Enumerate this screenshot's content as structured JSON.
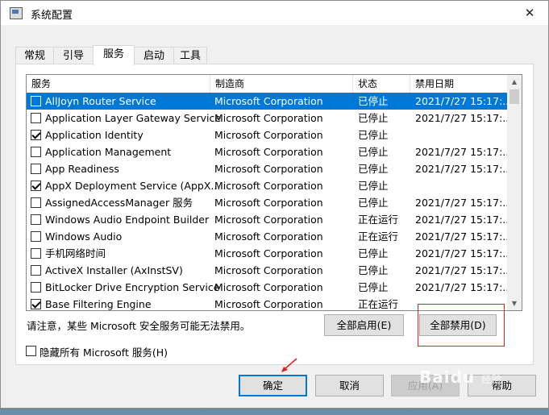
{
  "window": {
    "title": "系统配置",
    "close_glyph": "✕"
  },
  "tabs": [
    {
      "label": "常规"
    },
    {
      "label": "引导"
    },
    {
      "label": "服务"
    },
    {
      "label": "启动"
    },
    {
      "label": "工具"
    }
  ],
  "active_tab": "服务",
  "columns": [
    "服务",
    "制造商",
    "状态",
    "禁用日期"
  ],
  "services": [
    {
      "name": "AllJoyn Router Service",
      "manufacturer": "Microsoft Corporation",
      "status": "已停止",
      "disabled_date": "2021/7/27 15:17:...",
      "checked": false,
      "selected": true
    },
    {
      "name": "Application Layer Gateway Service",
      "manufacturer": "Microsoft Corporation",
      "status": "已停止",
      "disabled_date": "2021/7/27 15:17:...",
      "checked": false
    },
    {
      "name": "Application Identity",
      "manufacturer": "Microsoft Corporation",
      "status": "已停止",
      "disabled_date": "",
      "checked": true
    },
    {
      "name": "Application Management",
      "manufacturer": "Microsoft Corporation",
      "status": "已停止",
      "disabled_date": "2021/7/27 15:17:...",
      "checked": false
    },
    {
      "name": "App Readiness",
      "manufacturer": "Microsoft Corporation",
      "status": "已停止",
      "disabled_date": "2021/7/27 15:17:...",
      "checked": false
    },
    {
      "name": "AppX Deployment Service (AppX...",
      "manufacturer": "Microsoft Corporation",
      "status": "已停止",
      "disabled_date": "",
      "checked": true
    },
    {
      "name": "AssignedAccessManager 服务",
      "manufacturer": "Microsoft Corporation",
      "status": "已停止",
      "disabled_date": "2021/7/27 15:17:...",
      "checked": false
    },
    {
      "name": "Windows Audio Endpoint Builder",
      "manufacturer": "Microsoft Corporation",
      "status": "正在运行",
      "disabled_date": "2021/7/27 15:17:...",
      "checked": false
    },
    {
      "name": "Windows Audio",
      "manufacturer": "Microsoft Corporation",
      "status": "正在运行",
      "disabled_date": "2021/7/27 15:17:...",
      "checked": false
    },
    {
      "name": "手机网络时间",
      "manufacturer": "Microsoft Corporation",
      "status": "已停止",
      "disabled_date": "2021/7/27 15:17:...",
      "checked": false
    },
    {
      "name": "ActiveX Installer (AxInstSV)",
      "manufacturer": "Microsoft Corporation",
      "status": "已停止",
      "disabled_date": "2021/7/27 15:17:...",
      "checked": false
    },
    {
      "name": "BitLocker Drive Encryption Service",
      "manufacturer": "Microsoft Corporation",
      "status": "已停止",
      "disabled_date": "2021/7/27 15:17:...",
      "checked": false
    },
    {
      "name": "Base Filtering Engine",
      "manufacturer": "Microsoft Corporation",
      "status": "正在运行",
      "disabled_date": "",
      "checked": true
    }
  ],
  "notice": "请注意，某些 Microsoft 安全服务可能无法禁用。",
  "buttons": {
    "enable_all": "全部启用(E)",
    "disable_all": "全部禁用(D)",
    "ok": "确定",
    "cancel": "取消",
    "apply": "应用(A)",
    "help": "帮助"
  },
  "hide_ms_label": "隐藏所有 Microsoft 服务(H)",
  "hide_ms_checked": false,
  "watermark": {
    "brand": "Baidu",
    "sub": "经验"
  },
  "colors": {
    "selection": "#0078d7",
    "annotation": "#e02020"
  }
}
